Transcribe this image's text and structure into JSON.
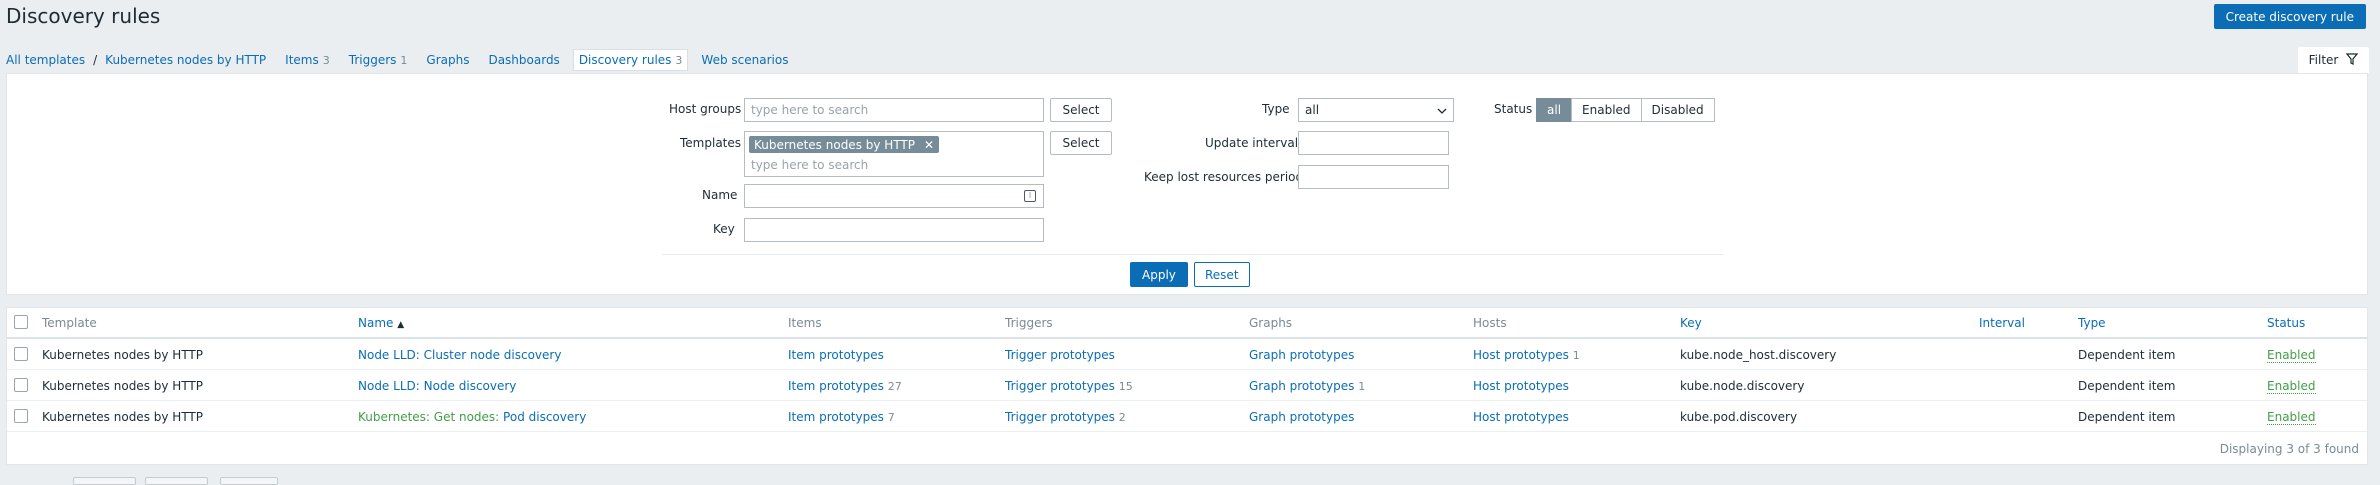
{
  "page": {
    "title": "Discovery rules",
    "create_button": "Create discovery rule"
  },
  "nav": {
    "all_templates": "All templates",
    "separator": "/",
    "template": "Kubernetes nodes by HTTP",
    "items_label": "Items",
    "items_count": "3",
    "triggers_label": "Triggers",
    "triggers_count": "1",
    "graphs_label": "Graphs",
    "dashboards_label": "Dashboards",
    "discovery_label": "Discovery rules",
    "discovery_count": "3",
    "web_label": "Web scenarios"
  },
  "filter": {
    "tab_label": "Filter",
    "host_groups_label": "Host groups",
    "host_groups_placeholder": "type here to search",
    "templates_label": "Templates",
    "templates_tag": "Kubernetes nodes by HTTP",
    "templates_placeholder": "type here to search",
    "select_label": "Select",
    "name_label": "Name",
    "name_value": "",
    "key_label": "Key",
    "key_value": "",
    "type_label": "Type",
    "type_value": "all",
    "update_interval_label": "Update interval",
    "update_interval_value": "",
    "keep_lost_label": "Keep lost resources period",
    "keep_lost_value": "",
    "status_label": "Status",
    "status_options": [
      "all",
      "Enabled",
      "Disabled"
    ],
    "status_selected": "all",
    "apply_label": "Apply",
    "reset_label": "Reset"
  },
  "table": {
    "headers": {
      "template": "Template",
      "name": "Name",
      "sort_indicator": "▲",
      "items": "Items",
      "triggers": "Triggers",
      "graphs": "Graphs",
      "hosts": "Hosts",
      "key": "Key",
      "interval": "Interval",
      "type": "Type",
      "status": "Status"
    },
    "rows": [
      {
        "template": "Kubernetes nodes by HTTP",
        "name_prefix": "Node LLD: ",
        "name": "Cluster node discovery",
        "items": "Item prototypes",
        "items_count": "",
        "triggers": "Trigger prototypes",
        "triggers_count": "",
        "graphs": "Graph prototypes",
        "graphs_count": "",
        "hosts": "Host prototypes",
        "hosts_count": "1",
        "key": "kube.node_host.discovery",
        "interval": "",
        "type": "Dependent item",
        "status": "Enabled"
      },
      {
        "template": "Kubernetes nodes by HTTP",
        "name_prefix": "Node LLD: ",
        "name": "Node discovery",
        "items": "Item prototypes",
        "items_count": "27",
        "triggers": "Trigger prototypes",
        "triggers_count": "15",
        "graphs": "Graph prototypes",
        "graphs_count": "1",
        "hosts": "Host prototypes",
        "hosts_count": "",
        "key": "kube.node.discovery",
        "interval": "",
        "type": "Dependent item",
        "status": "Enabled"
      },
      {
        "template": "Kubernetes nodes by HTTP",
        "name_prefix": "Kubernetes: Get nodes: ",
        "name": "Pod discovery",
        "items": "Item prototypes",
        "items_count": "7",
        "triggers": "Trigger prototypes",
        "triggers_count": "2",
        "graphs": "Graph prototypes",
        "graphs_count": "",
        "hosts": "Host prototypes",
        "hosts_count": "",
        "key": "kube.pod.discovery",
        "interval": "",
        "type": "Dependent item",
        "status": "Enabled"
      }
    ],
    "footer": "Displaying 3 of 3 found"
  },
  "colors": {
    "accent": "#0a6db5",
    "enabled": "#429e47",
    "tag_bg": "#768d99",
    "page_bg": "#ebeef0"
  },
  "icons": {
    "filter": "funnel-icon",
    "tag_remove": "close-icon",
    "dropdown": "chevron-down-icon",
    "macro": "macro-icon"
  }
}
